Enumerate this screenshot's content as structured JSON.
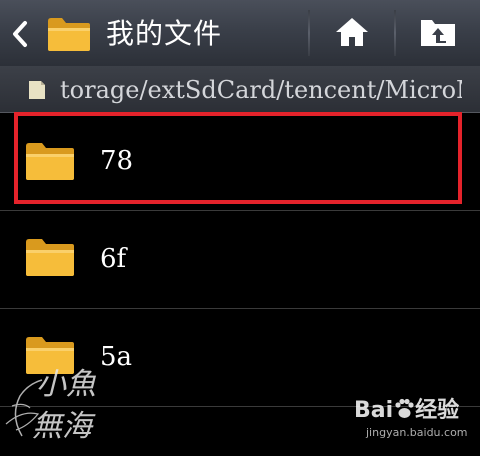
{
  "header": {
    "title": "我的文件",
    "back_icon": "chevron-left-icon",
    "folder_icon": "folder-icon",
    "home_icon": "home-icon",
    "up_icon": "folder-up-icon"
  },
  "path_bar": {
    "path": "torage/extSdCard/tencent/MicroMsg",
    "icon": "sd-card-icon"
  },
  "files": [
    {
      "name": "78",
      "type": "folder",
      "highlighted": true
    },
    {
      "name": "6f",
      "type": "folder",
      "highlighted": false
    },
    {
      "name": "5a",
      "type": "folder",
      "highlighted": false
    }
  ],
  "watermarks": {
    "left_line1": "小魚",
    "left_line2": "無海",
    "brand_a": "Bai",
    "brand_b": "经验",
    "url": "jingyan.baidu.com"
  },
  "colors": {
    "highlight": "#e5232b",
    "folder": "#f2b733",
    "action_bar": "#3a3f49"
  }
}
